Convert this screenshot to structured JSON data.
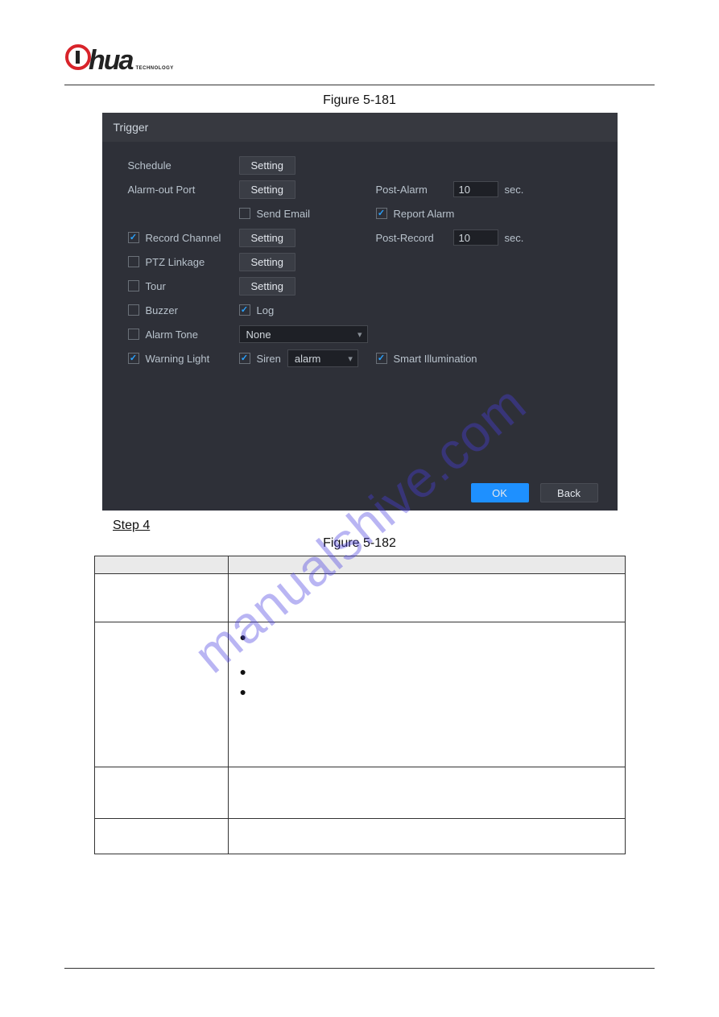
{
  "logo": {
    "at": "@",
    "hua": "hua",
    "sub": "TECHNOLOGY"
  },
  "figcap1": "Figure 5-181",
  "figcap2": "Figure 5-182",
  "panel": {
    "title": "Trigger",
    "schedule": "Schedule",
    "alarmout": "Alarm-out Port",
    "sendemail": "Send Email",
    "reportalarm": "Report Alarm",
    "postalarm": "Post-Alarm",
    "postalarm_val": "10",
    "postrecord": "Post-Record",
    "postrecord_val": "10",
    "sec": "sec.",
    "recordch": "Record Channel",
    "ptz": "PTZ Linkage",
    "tour": "Tour",
    "buzzer": "Buzzer",
    "log": "Log",
    "alarmtone": "Alarm Tone",
    "alarmtone_sel": "None",
    "warnlight": "Warning Light",
    "siren": "Siren",
    "siren_sel": "alarm",
    "smartillum": "Smart Illumination",
    "setting_btn": "Setting",
    "ok": "OK",
    "back": "Back"
  },
  "step4": "Step 4",
  "table": {
    "bullets": [
      "●",
      "●",
      "●"
    ]
  },
  "watermark": "manualshive.com"
}
